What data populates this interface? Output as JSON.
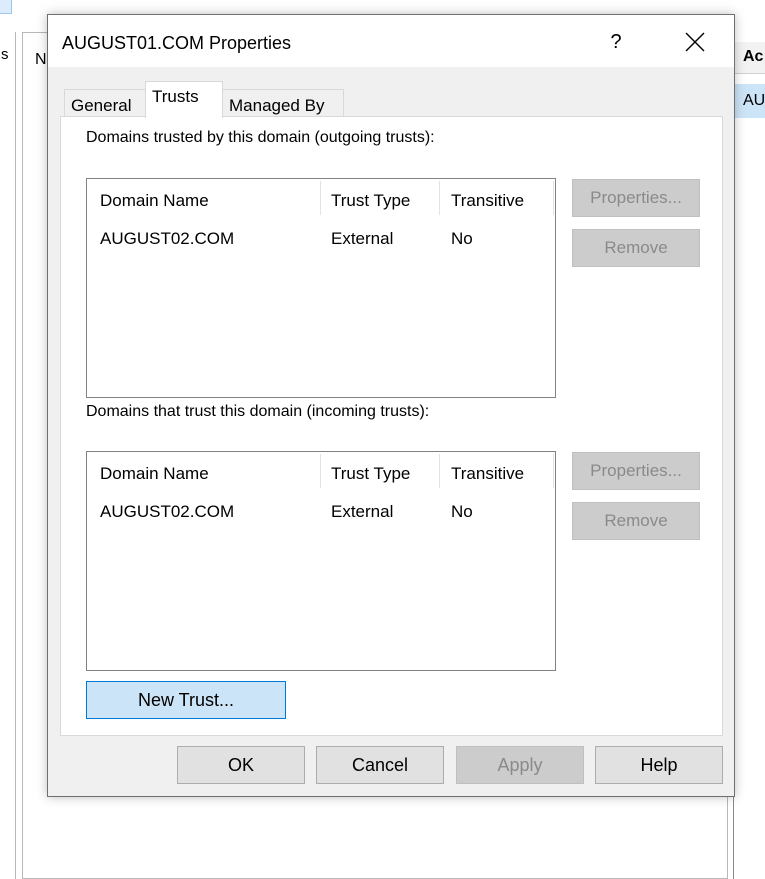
{
  "background": {
    "left_cut_text": "s",
    "mid_cut_text": "N",
    "right_header_cut": "Ac",
    "right_row_cut": "AU"
  },
  "dialog": {
    "title": "AUGUST01.COM Properties",
    "help_label": "?",
    "close_icon": "close-icon"
  },
  "tabs": [
    {
      "label": "General",
      "active": false
    },
    {
      "label": "Trusts",
      "active": true
    },
    {
      "label": "Managed By",
      "active": false
    }
  ],
  "outgoing": {
    "label": "Domains trusted by this domain (outgoing trusts):",
    "columns": [
      "Domain Name",
      "Trust Type",
      "Transitive"
    ],
    "rows": [
      {
        "domain": "AUGUST02.COM",
        "type": "External",
        "transitive": "No"
      }
    ],
    "properties_label": "Properties...",
    "remove_label": "Remove"
  },
  "incoming": {
    "label": "Domains that trust this domain (incoming trusts):",
    "columns": [
      "Domain Name",
      "Trust Type",
      "Transitive"
    ],
    "rows": [
      {
        "domain": "AUGUST02.COM",
        "type": "External",
        "transitive": "No"
      }
    ],
    "properties_label": "Properties...",
    "remove_label": "Remove"
  },
  "new_trust_label": "New Trust...",
  "footer": {
    "ok": "OK",
    "cancel": "Cancel",
    "apply": "Apply",
    "help": "Help"
  },
  "colors": {
    "dialog_bg": "#f0f0f0",
    "accent_button_bg": "#cce4f7",
    "accent_border": "#0078d7",
    "disabled_text": "#8a8a8a"
  }
}
